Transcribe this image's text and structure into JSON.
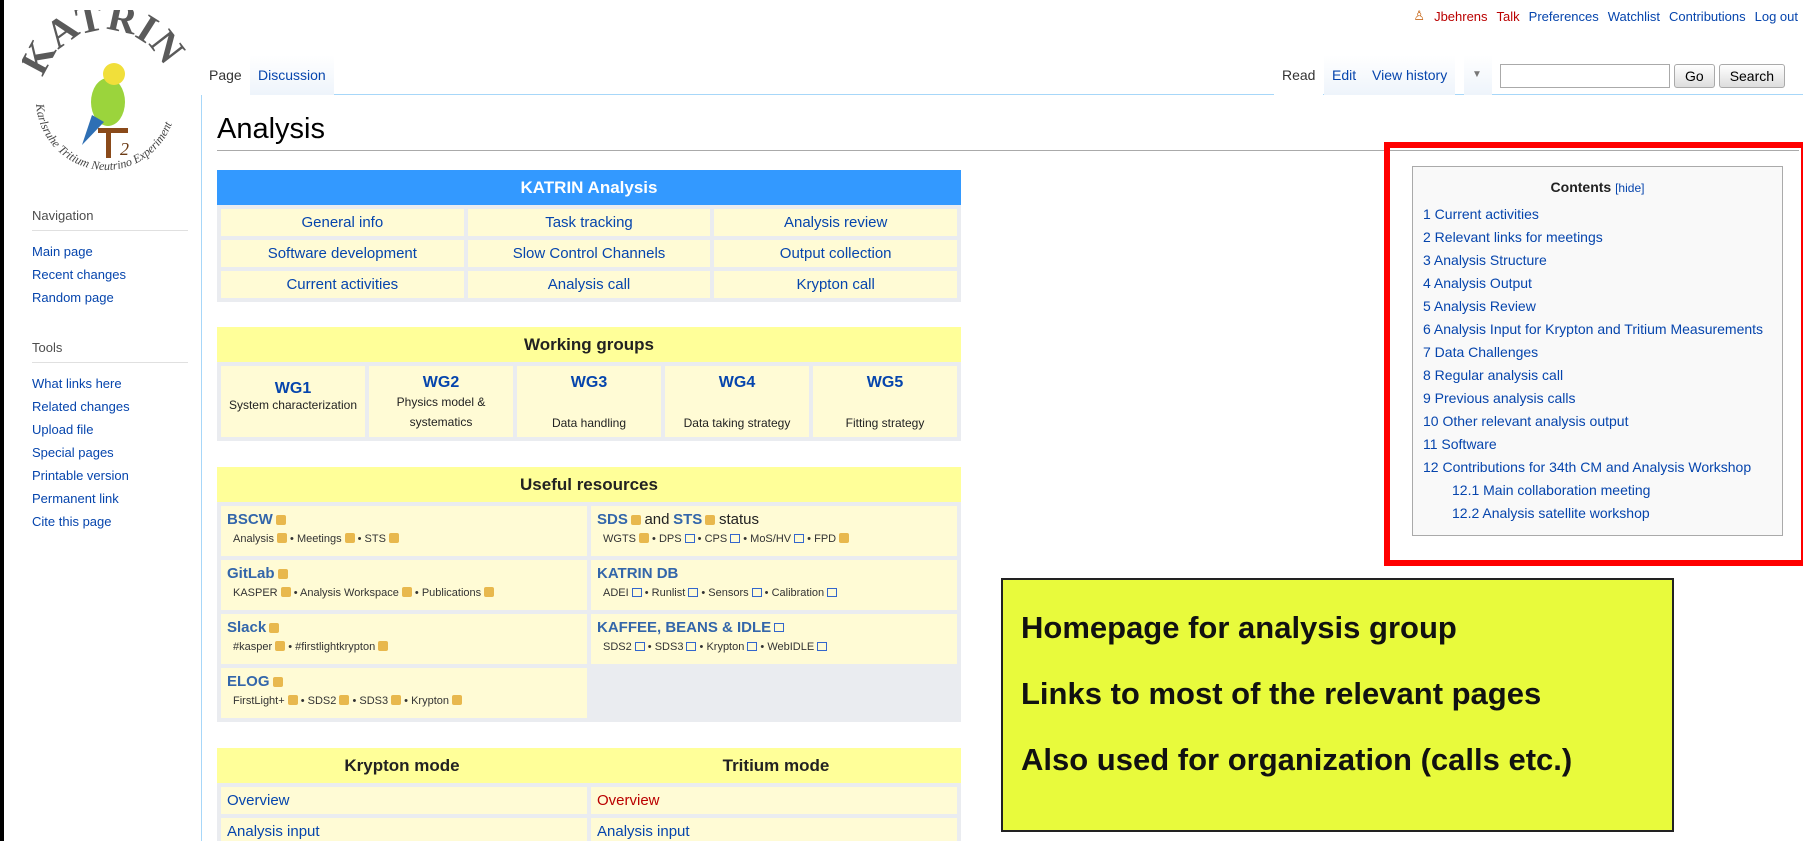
{
  "personal": {
    "user": "Jbehrens",
    "talk": "Talk",
    "preferences": "Preferences",
    "watchlist": "Watchlist",
    "contributions": "Contributions",
    "logout": "Log out"
  },
  "tabs": {
    "page": "Page",
    "discussion": "Discussion",
    "read": "Read",
    "edit": "Edit",
    "history": "View history"
  },
  "search": {
    "go": "Go",
    "search": "Search"
  },
  "logo": {
    "arc_top": "KATRIN",
    "arc_bottom": "Karlsruhe Tritium Neutrino Experiment"
  },
  "sidebar": {
    "nav_heading": "Navigation",
    "nav": [
      "Main page",
      "Recent changes",
      "Random page"
    ],
    "tools_heading": "Tools",
    "tools": [
      "What links here",
      "Related changes",
      "Upload file",
      "Special pages",
      "Printable version",
      "Permanent link",
      "Cite this page"
    ]
  },
  "title": "Analysis",
  "analysis_box": {
    "heading": "KATRIN Analysis",
    "cells": [
      "General info",
      "Task tracking",
      "Analysis review",
      "Software development",
      "Slow Control Channels",
      "Output collection",
      "Current activities",
      "Analysis call",
      "Krypton call"
    ]
  },
  "wg_box": {
    "heading": "Working groups",
    "items": [
      {
        "t": "WG1",
        "s": "System characterization"
      },
      {
        "t": "WG2",
        "s": "Physics model & systematics"
      },
      {
        "t": "WG3",
        "s": "Data handling"
      },
      {
        "t": "WG4",
        "s": "Data taking strategy"
      },
      {
        "t": "WG5",
        "s": "Fitting strategy"
      }
    ]
  },
  "res_box": {
    "heading": "Useful resources",
    "bscw": "BSCW",
    "bscw_sub": [
      "Analysis",
      "Meetings",
      "STS"
    ],
    "sds": "SDS",
    "sds_and": "and",
    "sts": "STS",
    "sds_status": "status",
    "sds_sub": [
      "WGTS",
      "DPS",
      "CPS",
      "MoS/HV",
      "FPD"
    ],
    "gitlab": "GitLab",
    "gitlab_sub": [
      "KASPER",
      "Analysis Workspace",
      "Publications"
    ],
    "katrindb": "KATRIN DB",
    "katrindb_sub": [
      "ADEI",
      "Runlist",
      "Sensors",
      "Calibration"
    ],
    "slack": "Slack",
    "slack_sub": [
      "#kasper",
      "#firstlightkrypton"
    ],
    "kaffee": "KAFFEE, BEANS & IDLE",
    "kaffee_sub": [
      "SDS2",
      "SDS3",
      "Krypton",
      "WebIDLE"
    ],
    "elog": "ELOG",
    "elog_sub": [
      "FirstLight+",
      "SDS2",
      "SDS3",
      "Krypton"
    ]
  },
  "mode_box": {
    "krypton": "Krypton mode",
    "tritium": "Tritium mode",
    "k_items": [
      "Overview",
      "Analysis input"
    ],
    "t_items": [
      "Overview",
      "Analysis input"
    ]
  },
  "toc": {
    "title": "Contents",
    "hide": "[hide]",
    "items": [
      "1 Current activities",
      "2 Relevant links for meetings",
      "3 Analysis Structure",
      "4 Analysis Output",
      "5 Analysis Review",
      "6 Analysis Input for Krypton and Tritium Measurements",
      "7 Data Challenges",
      "8 Regular analysis call",
      "9 Previous analysis calls",
      "10 Other relevant analysis output",
      "11 Software",
      "12 Contributions for 34th CM and Analysis Workshop"
    ],
    "sub": [
      "12.1 Main collaboration meeting",
      "12.2 Analysis satellite workshop"
    ]
  },
  "note": {
    "l1": "Homepage for analysis group",
    "l2": "Links to most of the relevant pages",
    "l3": "Also used for organization (calls etc.)"
  },
  "colors": {
    "header_blue": "#3399ff",
    "header_yellow": "#ffff99",
    "cell_bg": "#fffbd5",
    "note_bg": "#e8fa3c",
    "highlight": "#ff0000"
  }
}
